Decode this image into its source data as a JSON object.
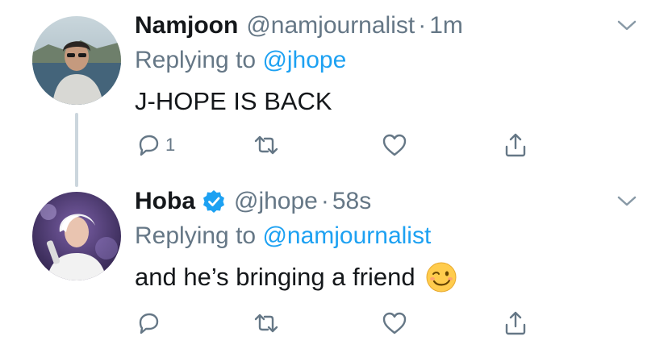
{
  "colors": {
    "text": "#14171a",
    "secondary": "#657786",
    "link": "#1da1f2",
    "thread_line": "#ccd6dd",
    "verified": "#1da1f2"
  },
  "tweets": [
    {
      "name": "Namjoon",
      "handle": "@namjournalist",
      "separator": "·",
      "time": "1m",
      "replying_prefix": "Replying to",
      "replying_to": "@jhope",
      "text": "J-HOPE IS BACK",
      "verified": false,
      "reply_count": "1",
      "avatar_icon": "user-avatar-photo"
    },
    {
      "name": "Hoba",
      "handle": "@jhope",
      "separator": "·",
      "time": "58s",
      "replying_prefix": "Replying to",
      "replying_to": "@namjournalist",
      "text": "and he’s bringing a friend",
      "verified": true,
      "emoji": "winking-face-emoji",
      "reply_count": "",
      "avatar_icon": "user-avatar-photo"
    }
  ]
}
